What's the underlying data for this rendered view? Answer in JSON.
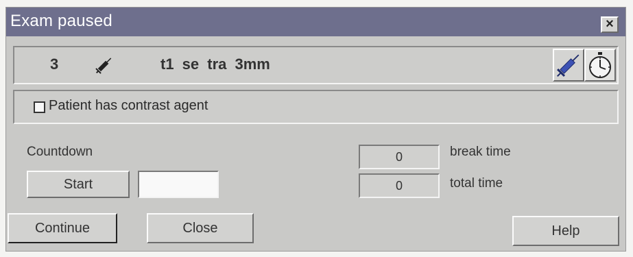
{
  "window": {
    "title": "Exam paused",
    "close_glyph": "×"
  },
  "series": {
    "number": "3",
    "protocol": "t1  se  tra  3mm",
    "contrast_icon": "syringe-icon"
  },
  "toolbar": {
    "icons": [
      "syringe-icon",
      "stopwatch-icon"
    ]
  },
  "contrast": {
    "label": "Patient has contrast agent",
    "checked": false
  },
  "countdown": {
    "label": "Countdown",
    "start_label": "Start",
    "value": ""
  },
  "timers": {
    "break_value": "0",
    "break_label": "break time",
    "total_value": "0",
    "total_label": "total time"
  },
  "buttons": {
    "continue": "Continue",
    "close": "Close",
    "help": "Help"
  },
  "colors": {
    "titlebar": "#6e6f8d",
    "dialog": "#c9c9c7",
    "syringe": "#3d52b4"
  }
}
